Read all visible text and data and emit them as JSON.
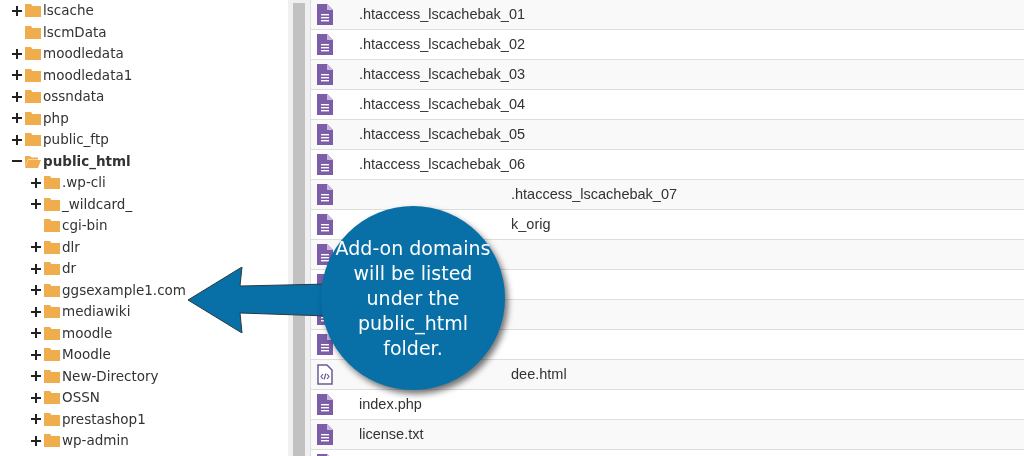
{
  "tree": [
    {
      "name": "lscache",
      "kind": "branch",
      "expanded": false
    },
    {
      "name": "lscmData",
      "kind": "leaf",
      "expanded": false
    },
    {
      "name": "moodledata",
      "kind": "branch",
      "expanded": false
    },
    {
      "name": "moodledata1",
      "kind": "branch",
      "expanded": false
    },
    {
      "name": "ossndata",
      "kind": "branch",
      "expanded": false
    },
    {
      "name": "php",
      "kind": "branch",
      "expanded": false
    },
    {
      "name": "public_ftp",
      "kind": "branch",
      "expanded": false
    },
    {
      "name": "public_html",
      "kind": "branch",
      "expanded": true,
      "children": [
        {
          "name": ".wp-cli",
          "kind": "branch",
          "expanded": false
        },
        {
          "name": "_wildcard_",
          "kind": "branch",
          "expanded": false
        },
        {
          "name": "cgi-bin",
          "kind": "leaf",
          "expanded": false
        },
        {
          "name": "dlr",
          "kind": "branch",
          "expanded": false
        },
        {
          "name": "dr",
          "kind": "branch",
          "expanded": false
        },
        {
          "name": "ggsexample1.com",
          "kind": "branch",
          "expanded": false
        },
        {
          "name": "mediawiki",
          "kind": "branch",
          "expanded": false
        },
        {
          "name": "moodle",
          "kind": "branch",
          "expanded": false
        },
        {
          "name": "Moodle",
          "kind": "branch",
          "expanded": false
        },
        {
          "name": "New-Directory",
          "kind": "branch",
          "expanded": false
        },
        {
          "name": "OSSN",
          "kind": "branch",
          "expanded": false
        },
        {
          "name": "prestashop1",
          "kind": "branch",
          "expanded": false
        },
        {
          "name": "wp-admin",
          "kind": "branch",
          "expanded": false
        }
      ]
    }
  ],
  "files": [
    {
      "name": ".htaccess_lscachebak_01",
      "kind": "text"
    },
    {
      "name": ".htaccess_lscachebak_02",
      "kind": "text"
    },
    {
      "name": ".htaccess_lscachebak_03",
      "kind": "text"
    },
    {
      "name": ".htaccess_lscachebak_04",
      "kind": "text"
    },
    {
      "name": ".htaccess_lscachebak_05",
      "kind": "text"
    },
    {
      "name": ".htaccess_lscachebak_06",
      "kind": "text"
    },
    {
      "name": ".htaccess_lscachebak_07",
      "kind": "text"
    },
    {
      "name": "k_orig",
      "kind": "text"
    },
    {
      "kind": "text"
    },
    {
      "kind": "text"
    },
    {
      "kind": "text"
    },
    {
      "kind": "text"
    },
    {
      "name": "dee.html",
      "kind": "code"
    },
    {
      "name": "index.php",
      "kind": "text"
    },
    {
      "name": "license.txt",
      "kind": "text"
    },
    {
      "kind": "text"
    }
  ],
  "callout": {
    "text": "Add-on domains will be listed under the public_html folder."
  }
}
